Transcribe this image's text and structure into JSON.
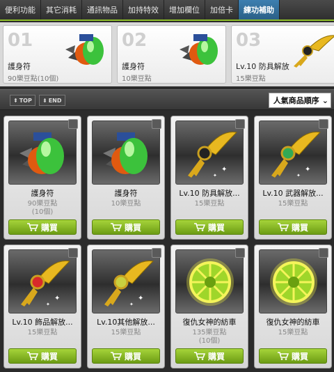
{
  "tabs": [
    {
      "label": "便利功能",
      "active": false
    },
    {
      "label": "其它消耗",
      "active": false
    },
    {
      "label": "通訊物品",
      "active": false
    },
    {
      "label": "加持特效",
      "active": false
    },
    {
      "label": "增加欄位",
      "active": false
    },
    {
      "label": "加倍卡",
      "active": false
    },
    {
      "label": "練功補助",
      "active": true
    }
  ],
  "featured": [
    {
      "num": "01",
      "name": "護身符",
      "price": "90樂豆點(10個)",
      "icon": "charm-icon"
    },
    {
      "num": "02",
      "name": "護身符",
      "price": "10樂豆點",
      "icon": "charm-icon"
    },
    {
      "num": "03",
      "name": "Lv.10 防具解放",
      "price": "15樂豆點",
      "icon": "winged-key-icon"
    }
  ],
  "toolbar": {
    "top_label": "TOP",
    "end_label": "END",
    "sort_label": "人氣商品順序"
  },
  "items": [
    {
      "name": "護身符",
      "price": "90樂豆點",
      "qty": "(10個)",
      "icon": "charm-icon",
      "buy": "購買"
    },
    {
      "name": "護身符",
      "price": "10樂豆點",
      "qty": "",
      "icon": "charm-icon",
      "buy": "購買"
    },
    {
      "name": "Lv.10 防具解放...",
      "price": "15樂豆點",
      "qty": "",
      "icon": "winged-key-black-icon",
      "buy": "購買"
    },
    {
      "name": "Lv.10 武器解放...",
      "price": "15樂豆點",
      "qty": "",
      "icon": "winged-key-green-icon",
      "buy": "購買"
    },
    {
      "name": "Lv.10 飾品解放...",
      "price": "15樂豆點",
      "qty": "",
      "icon": "winged-key-red-icon",
      "buy": "購買"
    },
    {
      "name": "Lv.10其他解放...",
      "price": "15樂豆點",
      "qty": "",
      "icon": "winged-key-gold-icon",
      "buy": "購買"
    },
    {
      "name": "復仇女神的紡車",
      "price": "135樂豆點",
      "qty": "(10個)",
      "icon": "spinning-wheel-icon",
      "buy": "購買"
    },
    {
      "name": "復仇女神的紡車",
      "price": "15樂豆點",
      "qty": "",
      "icon": "spinning-wheel-icon",
      "buy": "購買"
    }
  ],
  "colors": {
    "accent_green": "#8fbf2a",
    "active_tab": "#3d7fb0"
  }
}
